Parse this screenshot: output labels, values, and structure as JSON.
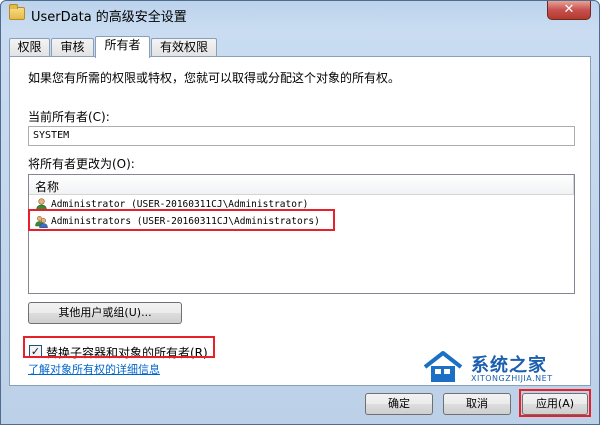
{
  "window": {
    "title": "UserData 的高级安全设置",
    "close_glyph": "✕"
  },
  "tabs": [
    {
      "label": "权限",
      "active": false
    },
    {
      "label": "审核",
      "active": false
    },
    {
      "label": "所有者",
      "active": true
    },
    {
      "label": "有效权限",
      "active": false
    }
  ],
  "panel": {
    "description": "如果您有所需的权限或特权，您就可以取得或分配这个对象的所有权。",
    "current_owner_label": "当前所有者(C):",
    "current_owner_value": "SYSTEM",
    "change_owner_label": "将所有者更改为(O):",
    "list_header": "名称",
    "list_items": [
      {
        "name": "Administrator (USER-20160311CJ\\Administrator)",
        "icon": "user-icon"
      },
      {
        "name": "Administrators (USER-20160311CJ\\Administrators)",
        "icon": "users-group-icon"
      }
    ],
    "other_users_button": "其他用户或组(U)...",
    "replace_checkbox_label": "替换子容器和对象的所有者(R)",
    "replace_checked": true,
    "learn_more_link": "了解对象所有权的详细信息"
  },
  "footer": {
    "ok": "确定",
    "cancel": "取消",
    "apply": "应用(A)"
  },
  "watermark": {
    "brand": "系统之家",
    "url": "XITONGZHIJIA.NET"
  }
}
